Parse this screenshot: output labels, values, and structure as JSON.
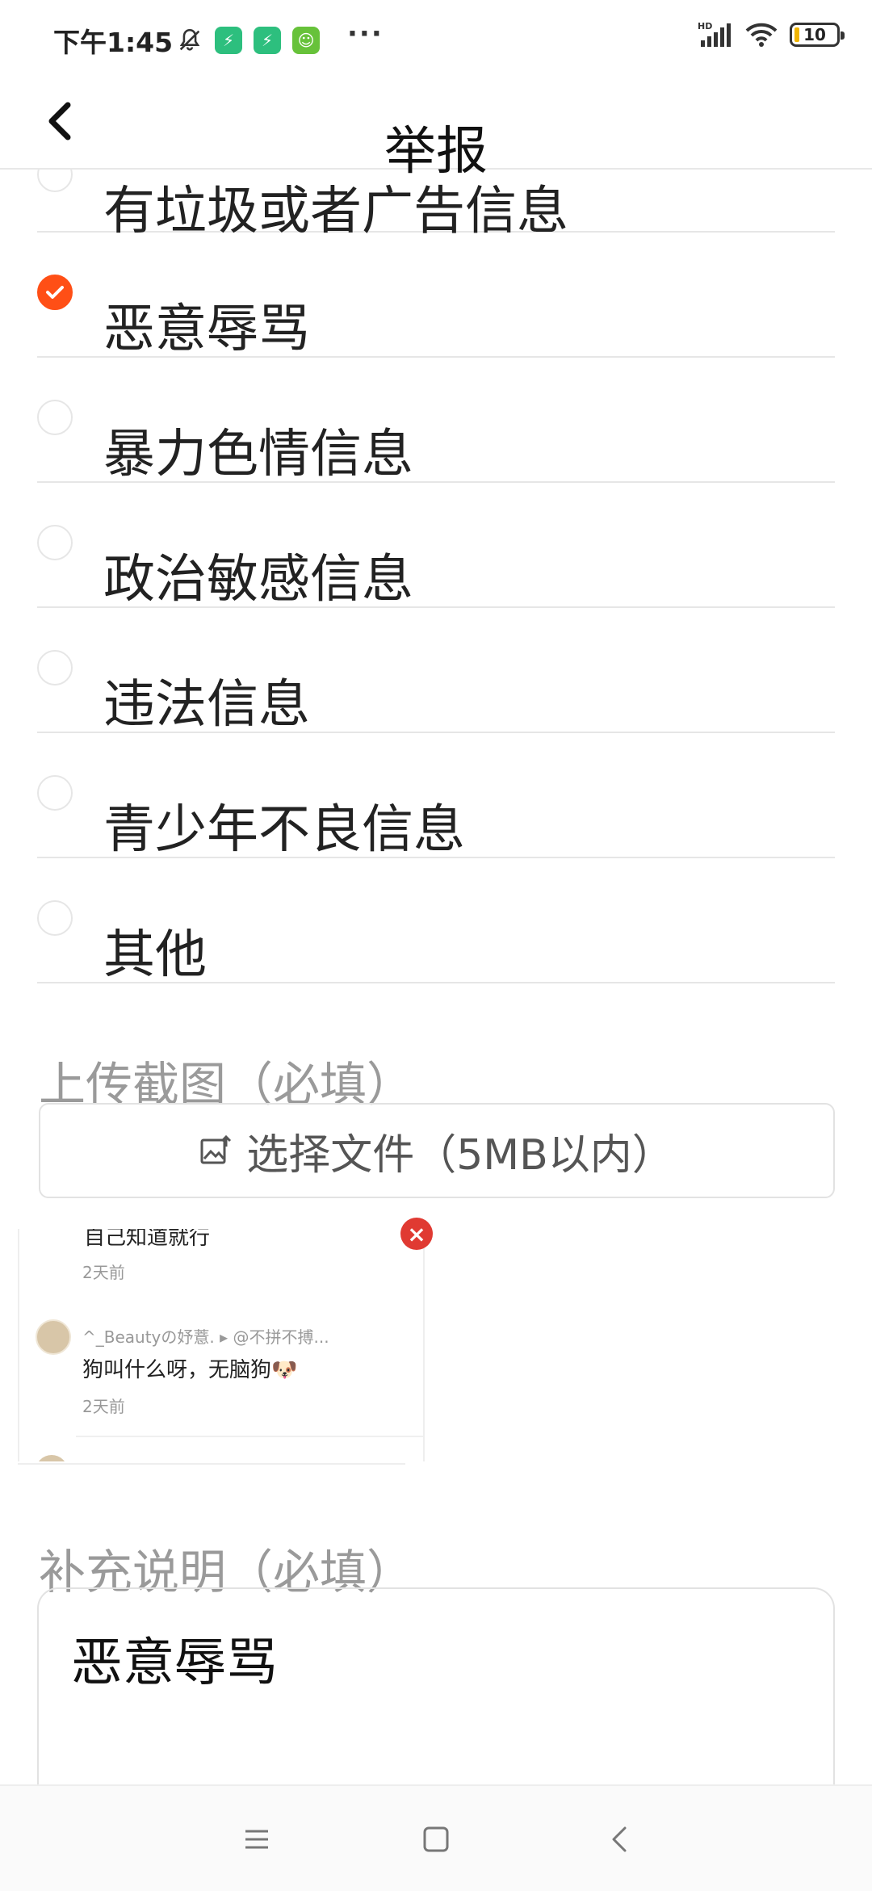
{
  "status_bar": {
    "time": "下午1:45",
    "more": "···",
    "network": "HD",
    "battery": "10"
  },
  "header": {
    "title": "举报"
  },
  "report_options": [
    {
      "label": "有垃圾或者广告信息",
      "selected": false
    },
    {
      "label": "恶意辱骂",
      "selected": true
    },
    {
      "label": "暴力色情信息",
      "selected": false
    },
    {
      "label": "政治敏感信息",
      "selected": false
    },
    {
      "label": "违法信息",
      "selected": false
    },
    {
      "label": "青少年不良信息",
      "selected": false
    },
    {
      "label": "其他",
      "selected": false
    }
  ],
  "upload": {
    "section_label": "上传截图（必填）",
    "button_label": "选择文件（5MB以内）"
  },
  "screenshot_preview": {
    "top_text": "自己知道就行",
    "time1": "2天前",
    "user_line": "^_Beautyの妤薏. ▸ @不拼不搏...",
    "comment": "狗叫什么呀，无脑狗🐶",
    "time2": "2天前"
  },
  "supplement": {
    "section_label": "补充说明（必填）",
    "value": "恶意辱骂"
  },
  "colors": {
    "accent": "#ff4f16",
    "delete": "#e03a32",
    "muted": "#9a9a9a"
  }
}
